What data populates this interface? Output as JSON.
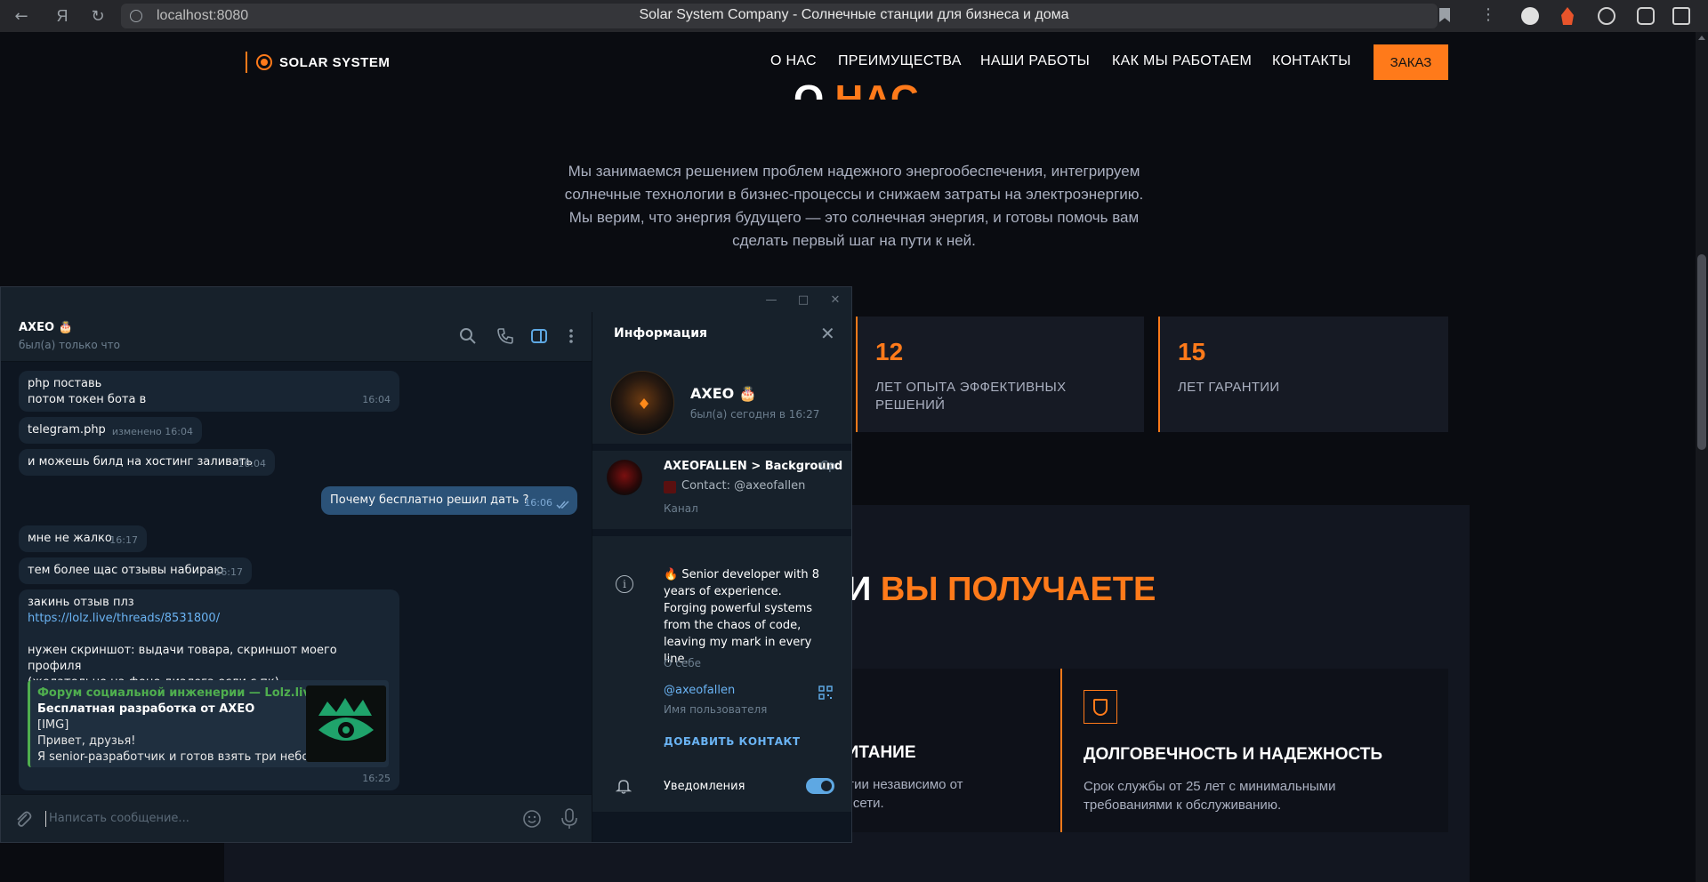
{
  "browser": {
    "url": "localhost:8080",
    "tab_title": "Solar System Company - Солнечные станции для бизнеса и дома"
  },
  "site": {
    "logo_text": "SOLAR SYSTEM",
    "nav": [
      "О НАС",
      "ПРЕИМУЩЕСТВА",
      "НАШИ РАБОТЫ",
      "КАК МЫ РАБОТАЕМ",
      "КОНТАКТЫ"
    ],
    "order_button": "ЗАКАЗ",
    "about_heading_white": "О ",
    "about_heading_orange": "НАС",
    "about_text": "Мы занимаемся решением проблем надежного энергообеспечения, интегрируем солнечные технологии в бизнес-процессы и снижаем затраты на электроэнергию. Мы верим, что энергия будущего — это солнечная энергия, и готовы помочь вам сделать первый шаг на пути к ней.",
    "stats": [
      {
        "number": "12",
        "label": "ЛЕТ ОПЫТА ЭФФЕКТИВНЫХ РЕШЕНИЙ"
      },
      {
        "number": "15",
        "label": "ЛЕТ ГАРАНТИИ"
      }
    ],
    "benefits_title_white": "И ",
    "benefits_title_orange": "ВЫ ПОЛУЧАЕТЕ",
    "benefit_partial_title": "ПИТАНИЕ",
    "benefit_partial_desc_1": "ергии независимо от",
    "benefit_partial_desc_2": "ой сети.",
    "benefit_card": {
      "title": "ДОЛГОВЕЧНОСТЬ И НАДЕЖНОСТЬ",
      "desc": "Срок службы от 25 лет с минимальными требованиями к обслуживанию.",
      "icon": "shield-icon"
    }
  },
  "telegram": {
    "chat": {
      "name": "AXEO 🎂",
      "status": "был(а) только что",
      "messages": [
        {
          "lines": [
            "php поставь",
            "потом токен бота в"
          ],
          "time": "16:04"
        },
        {
          "lines": [
            "telegram.php"
          ],
          "time": "изменено 16:04"
        },
        {
          "lines": [
            "и можешь билд на хостинг заливать"
          ],
          "time": "16:04"
        },
        {
          "lines": [
            "Почему бесплатно решил дать ?"
          ],
          "time": "16:06",
          "outgoing": true
        },
        {
          "lines": [
            "мне не жалко"
          ],
          "time": "16:17"
        },
        {
          "lines": [
            "тем более щас отзывы набираю"
          ],
          "time": "16:17"
        }
      ],
      "last_message": {
        "line1": "закинь отзыв плз",
        "link": "https://lolz.live/threads/8531800/",
        "line3": "нужен скриншот: выдачи товара, скриншот моего профиля",
        "line4": "(желательно на фоне диалога если с пк)",
        "time": "16:25",
        "preview": {
          "site": "Форум социальной инженерии — Lolz.live...",
          "title": "Бесплатная разработка от AXEO",
          "line1": "[IMG]",
          "line2": "Привет, друзья!",
          "line3": "Я senior-разработчик и готов взять три небо..."
        }
      },
      "composer_placeholder": "Написать сообщение..."
    },
    "info": {
      "title": "Информация",
      "profile_name": "AXEO 🎂",
      "profile_status": "был(а) сегодня в 16:27",
      "channel_name": "AXEOFALLEN > Background",
      "channel_day": "Ср",
      "channel_contact": "Contact: @axeofallen",
      "channel_type": "Канал",
      "bio": "🔥 Senior developer with 8 years of experience. Forging powerful systems from the chaos of code, leaving my mark in every line.",
      "bio_label": "О себе",
      "username": "@axeofallen",
      "username_label": "Имя пользователя",
      "add_contact": "ДОБАВИТЬ КОНТАКТ",
      "notifications": "Уведомления",
      "notifications_on": true
    }
  },
  "colors": {
    "accent": "#ff7a1a",
    "tg_bg": "#17212b",
    "tg_chat_bg": "#0e1621",
    "tg_link": "#6ab3f3"
  }
}
